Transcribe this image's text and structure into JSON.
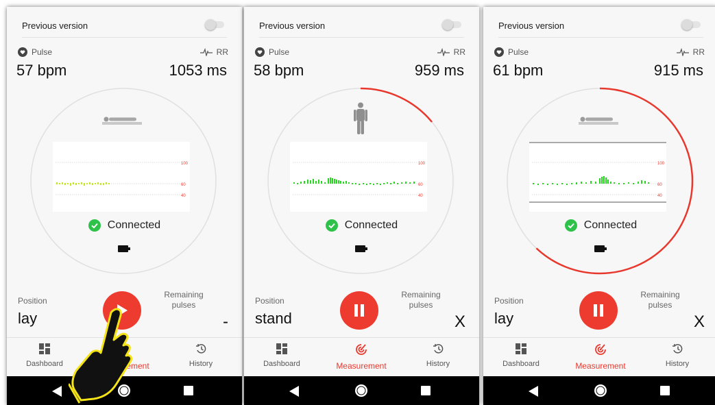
{
  "colors": {
    "accent": "#e8382d",
    "ring_track": "#e0e0e0",
    "connected": "#2fc24a",
    "bar_green": "#27d61e",
    "bar_yellow": "#c6e81f"
  },
  "screens": [
    {
      "previous_version": "Previous version",
      "pulse_label": "Pulse",
      "rr_label": "RR",
      "pulse_value": "57 bpm",
      "rr_value": "1053 ms",
      "body_position_icon": "lying-person-icon",
      "ring_progress": 0,
      "chart_ticks": [
        "100",
        "60",
        "40"
      ],
      "status": "Connected",
      "position_label": "Position",
      "position_value": "lay",
      "remaining_label": "Remaining pulses",
      "remaining_value": "-",
      "control_icon": "play-icon",
      "nav": [
        "Dashboard",
        "Measurement",
        "History"
      ]
    },
    {
      "previous_version": "Previous version",
      "pulse_label": "Pulse",
      "rr_label": "RR",
      "pulse_value": "58 bpm",
      "rr_value": "959 ms",
      "body_position_icon": "standing-person-icon",
      "ring_progress": 0.14,
      "chart_ticks": [
        "100",
        "60",
        "40"
      ],
      "status": "Connected",
      "position_label": "Position",
      "position_value": "stand",
      "remaining_label": "Remaining pulses",
      "remaining_value": "X",
      "control_icon": "pause-icon",
      "nav": [
        "Dashboard",
        "Measurement",
        "History"
      ]
    },
    {
      "previous_version": "Previous version",
      "pulse_label": "Pulse",
      "rr_label": "RR",
      "pulse_value": "61 bpm",
      "rr_value": "915 ms",
      "body_position_icon": "lying-person-icon",
      "ring_progress": 0.62,
      "chart_ticks": [
        "100",
        "60",
        "40"
      ],
      "status": "Connected",
      "position_label": "Position",
      "position_value": "lay",
      "remaining_label": "Remaining pulses",
      "remaining_value": "X",
      "control_icon": "pause-icon",
      "nav": [
        "Dashboard",
        "Measurement",
        "History"
      ]
    }
  ]
}
